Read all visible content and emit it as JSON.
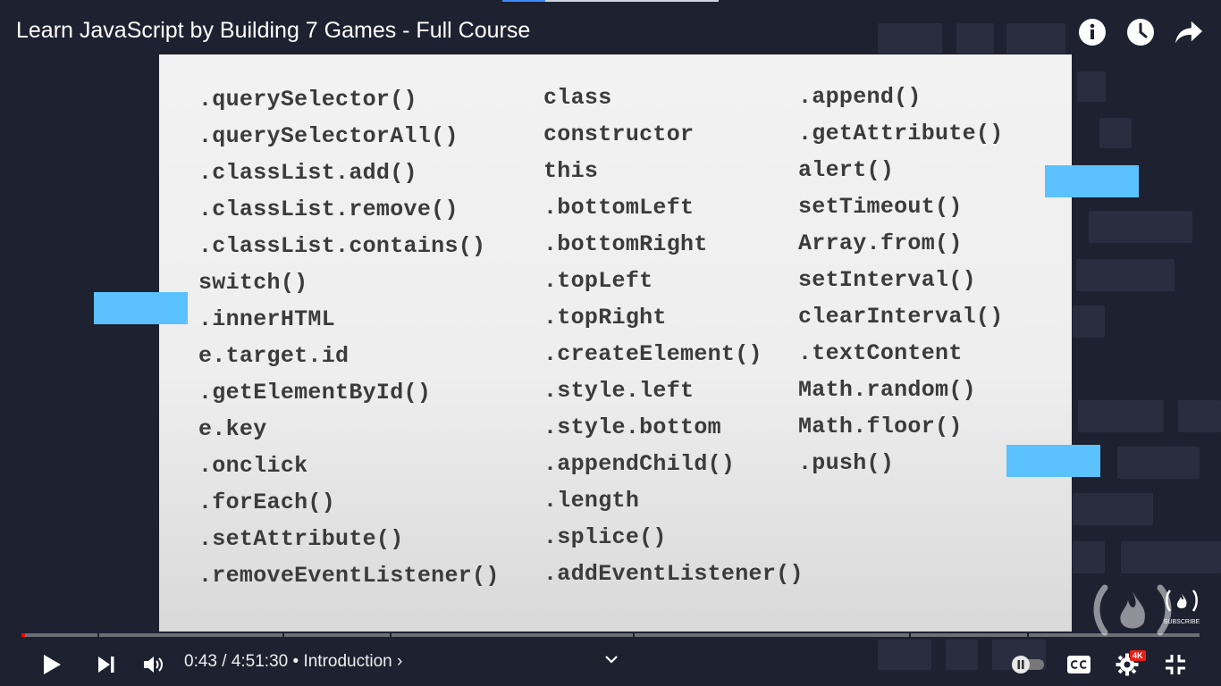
{
  "video": {
    "title": "Learn JavaScript by Building 7 Games - Full Course"
  },
  "top_icons": [
    "info-icon",
    "watch-later-clock-icon",
    "share-arrow-icon"
  ],
  "slide": {
    "column1": [
      ".querySelector()",
      ".querySelectorAll()",
      ".classList.add()",
      ".classList.remove()",
      ".classList.contains()",
      "switch()",
      ".innerHTML",
      "e.target.id",
      ".getElementById()",
      "e.key",
      ".onclick",
      ".forEach()",
      ".setAttribute()",
      ".removeEventListener()"
    ],
    "column2": [
      "class",
      "constructor",
      "this",
      ".bottomLeft",
      ".bottomRight",
      ".topLeft",
      ".topRight",
      ".createElement()",
      ".style.left",
      ".style.bottom",
      ".appendChild()",
      ".length",
      ".splice()",
      ".addEventListener()"
    ],
    "column3": [
      ".append()",
      ".getAttribute()",
      "alert()",
      "setTimeout()",
      "Array.from()",
      "setInterval()",
      "clearInterval()",
      ".textContent",
      "Math.random()",
      "Math.floor()",
      ".push()"
    ]
  },
  "logo": {
    "subscribe_text": "SUBSCRIBE"
  },
  "player": {
    "current_time": "0:43",
    "separator": " / ",
    "duration": "4:51:30",
    "chapter_prefix": " • ",
    "chapter": "Introduction",
    "chapter_chevron": "›",
    "quality_badge": "4K",
    "progress": 0.0025,
    "accent_color": "#ff0000"
  }
}
